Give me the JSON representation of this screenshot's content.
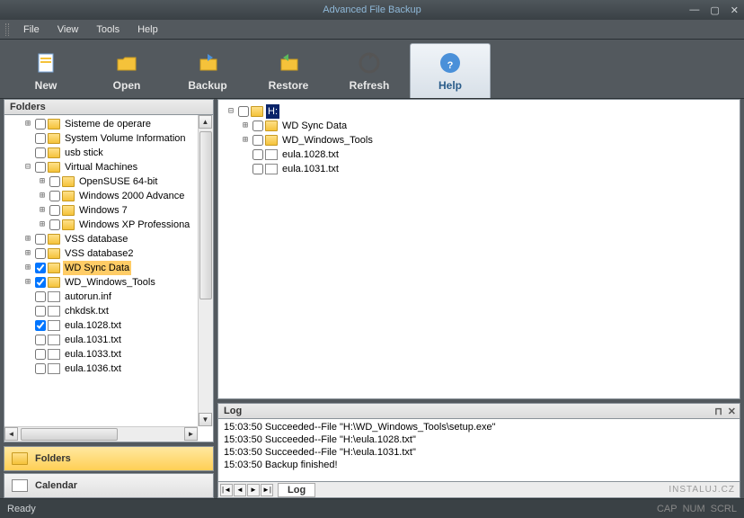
{
  "window": {
    "title": "Advanced File Backup"
  },
  "menu": {
    "file": "File",
    "view": "View",
    "tools": "Tools",
    "help": "Help"
  },
  "toolbar": {
    "new": "New",
    "open": "Open",
    "backup": "Backup",
    "restore": "Restore",
    "refresh": "Refresh",
    "help": "Help"
  },
  "panels": {
    "folders": "Folders"
  },
  "nav": {
    "folders": "Folders",
    "calendar": "Calendar"
  },
  "left_tree": [
    {
      "indent": 1,
      "expander": "+",
      "checked": false,
      "icon": "folder",
      "label": "Sisteme de operare"
    },
    {
      "indent": 1,
      "expander": "",
      "checked": false,
      "icon": "folder",
      "label": "System Volume Information"
    },
    {
      "indent": 1,
      "expander": "",
      "checked": false,
      "icon": "folder",
      "label": "usb stick"
    },
    {
      "indent": 1,
      "expander": "−",
      "checked": false,
      "icon": "folder",
      "label": "Virtual Machines"
    },
    {
      "indent": 2,
      "expander": "+",
      "checked": false,
      "icon": "folder",
      "label": "OpenSUSE 64-bit"
    },
    {
      "indent": 2,
      "expander": "+",
      "checked": false,
      "icon": "folder",
      "label": "Windows 2000 Advance"
    },
    {
      "indent": 2,
      "expander": "+",
      "checked": false,
      "icon": "folder",
      "label": "Windows 7"
    },
    {
      "indent": 2,
      "expander": "+",
      "checked": false,
      "icon": "folder",
      "label": "Windows XP Professiona"
    },
    {
      "indent": 1,
      "expander": "+",
      "checked": false,
      "icon": "folder",
      "label": "VSS database"
    },
    {
      "indent": 1,
      "expander": "+",
      "checked": false,
      "icon": "folder",
      "label": "VSS database2"
    },
    {
      "indent": 1,
      "expander": "+",
      "checked": true,
      "icon": "folder",
      "label": "WD Sync Data",
      "selected": true
    },
    {
      "indent": 1,
      "expander": "+",
      "checked": true,
      "icon": "folder",
      "label": "WD_Windows_Tools"
    },
    {
      "indent": 1,
      "expander": "",
      "checked": false,
      "icon": "file",
      "label": "autorun.inf"
    },
    {
      "indent": 1,
      "expander": "",
      "checked": false,
      "icon": "file",
      "label": "chkdsk.txt"
    },
    {
      "indent": 1,
      "expander": "",
      "checked": true,
      "icon": "file",
      "label": "eula.1028.txt"
    },
    {
      "indent": 1,
      "expander": "",
      "checked": false,
      "icon": "file",
      "label": "eula.1031.txt"
    },
    {
      "indent": 1,
      "expander": "",
      "checked": false,
      "icon": "file",
      "label": "eula.1033.txt"
    },
    {
      "indent": 1,
      "expander": "",
      "checked": false,
      "icon": "file",
      "label": "eula.1036.txt"
    }
  ],
  "main_tree": [
    {
      "indent": 0,
      "expander": "−",
      "checked": false,
      "icon": "folder",
      "label": "H:",
      "hsel": true
    },
    {
      "indent": 1,
      "expander": "+",
      "checked": false,
      "icon": "folder",
      "label": "WD Sync Data"
    },
    {
      "indent": 1,
      "expander": "+",
      "checked": false,
      "icon": "folder",
      "label": "WD_Windows_Tools"
    },
    {
      "indent": 1,
      "expander": "",
      "checked": false,
      "icon": "file",
      "label": "eula.1028.txt"
    },
    {
      "indent": 1,
      "expander": "",
      "checked": false,
      "icon": "file",
      "label": "eula.1031.txt"
    }
  ],
  "log": {
    "title": "Log",
    "tab": "Log",
    "lines": [
      "15:03:50 Succeeded--File \"H:\\WD_Windows_Tools\\setup.exe\"",
      "15:03:50 Succeeded--File \"H:\\eula.1028.txt\"",
      "15:03:50 Succeeded--File \"H:\\eula.1031.txt\"",
      "15:03:50 Backup finished!"
    ]
  },
  "status": {
    "ready": "Ready",
    "cap": "CAP",
    "num": "NUM",
    "scrl": "SCRL"
  },
  "watermark": "INSTALUJ.CZ"
}
